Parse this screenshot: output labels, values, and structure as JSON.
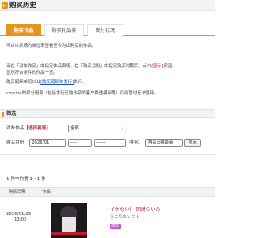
{
  "header": {
    "title": "购买历史"
  },
  "tabs": [
    {
      "label": "购买作品"
    },
    {
      "label": "购买礼品券"
    },
    {
      "label": "支付状况"
    }
  ],
  "intro": {
    "line1": "可以以卖场为单位来查看至今为止购买的作品。",
    "line2a": "请在「对象作品」中指定作品卖场，在「购买月份」中指定购买时期后，点击",
    "line2b": "[显示]",
    "line2c": "按钮。",
    "line3": "显示符合条件的作品一览。",
    "line4a": "购买明细单可以从",
    "line4link": "[购买明细单发行]",
    "line4b": "发行。",
    "line5": "comipo的部分服务（包括发行已购作品的客户描述模板等）目前暂时无法使用。"
  },
  "filter": {
    "section_title": "筛选",
    "target_label": "对象作品",
    "target_note": "【选择卖场】",
    "target_value": "全部",
    "month_label": "购买月份",
    "year_month_value": "2026/01",
    "day_value": "----",
    "day2_value": "------",
    "sort_label": "排序：",
    "sort_value": "购买日期最新",
    "display_button": "显示"
  },
  "results": {
    "count_text": "1 件中的第 1～1 件",
    "col_date": "购买日期",
    "col_item": "作品",
    "rows": [
      {
        "date": "2026/01/29",
        "time": "13:02",
        "title": "イケない！ 回縛らいみ",
        "maker": "らこりおソフト",
        "tag": "成年"
      }
    ]
  },
  "colors": {
    "accent": "#e8941a",
    "link": "#1a55c8",
    "warning": "#d6242c",
    "title_red": "#c0182e",
    "tag": "#c74fd6"
  }
}
